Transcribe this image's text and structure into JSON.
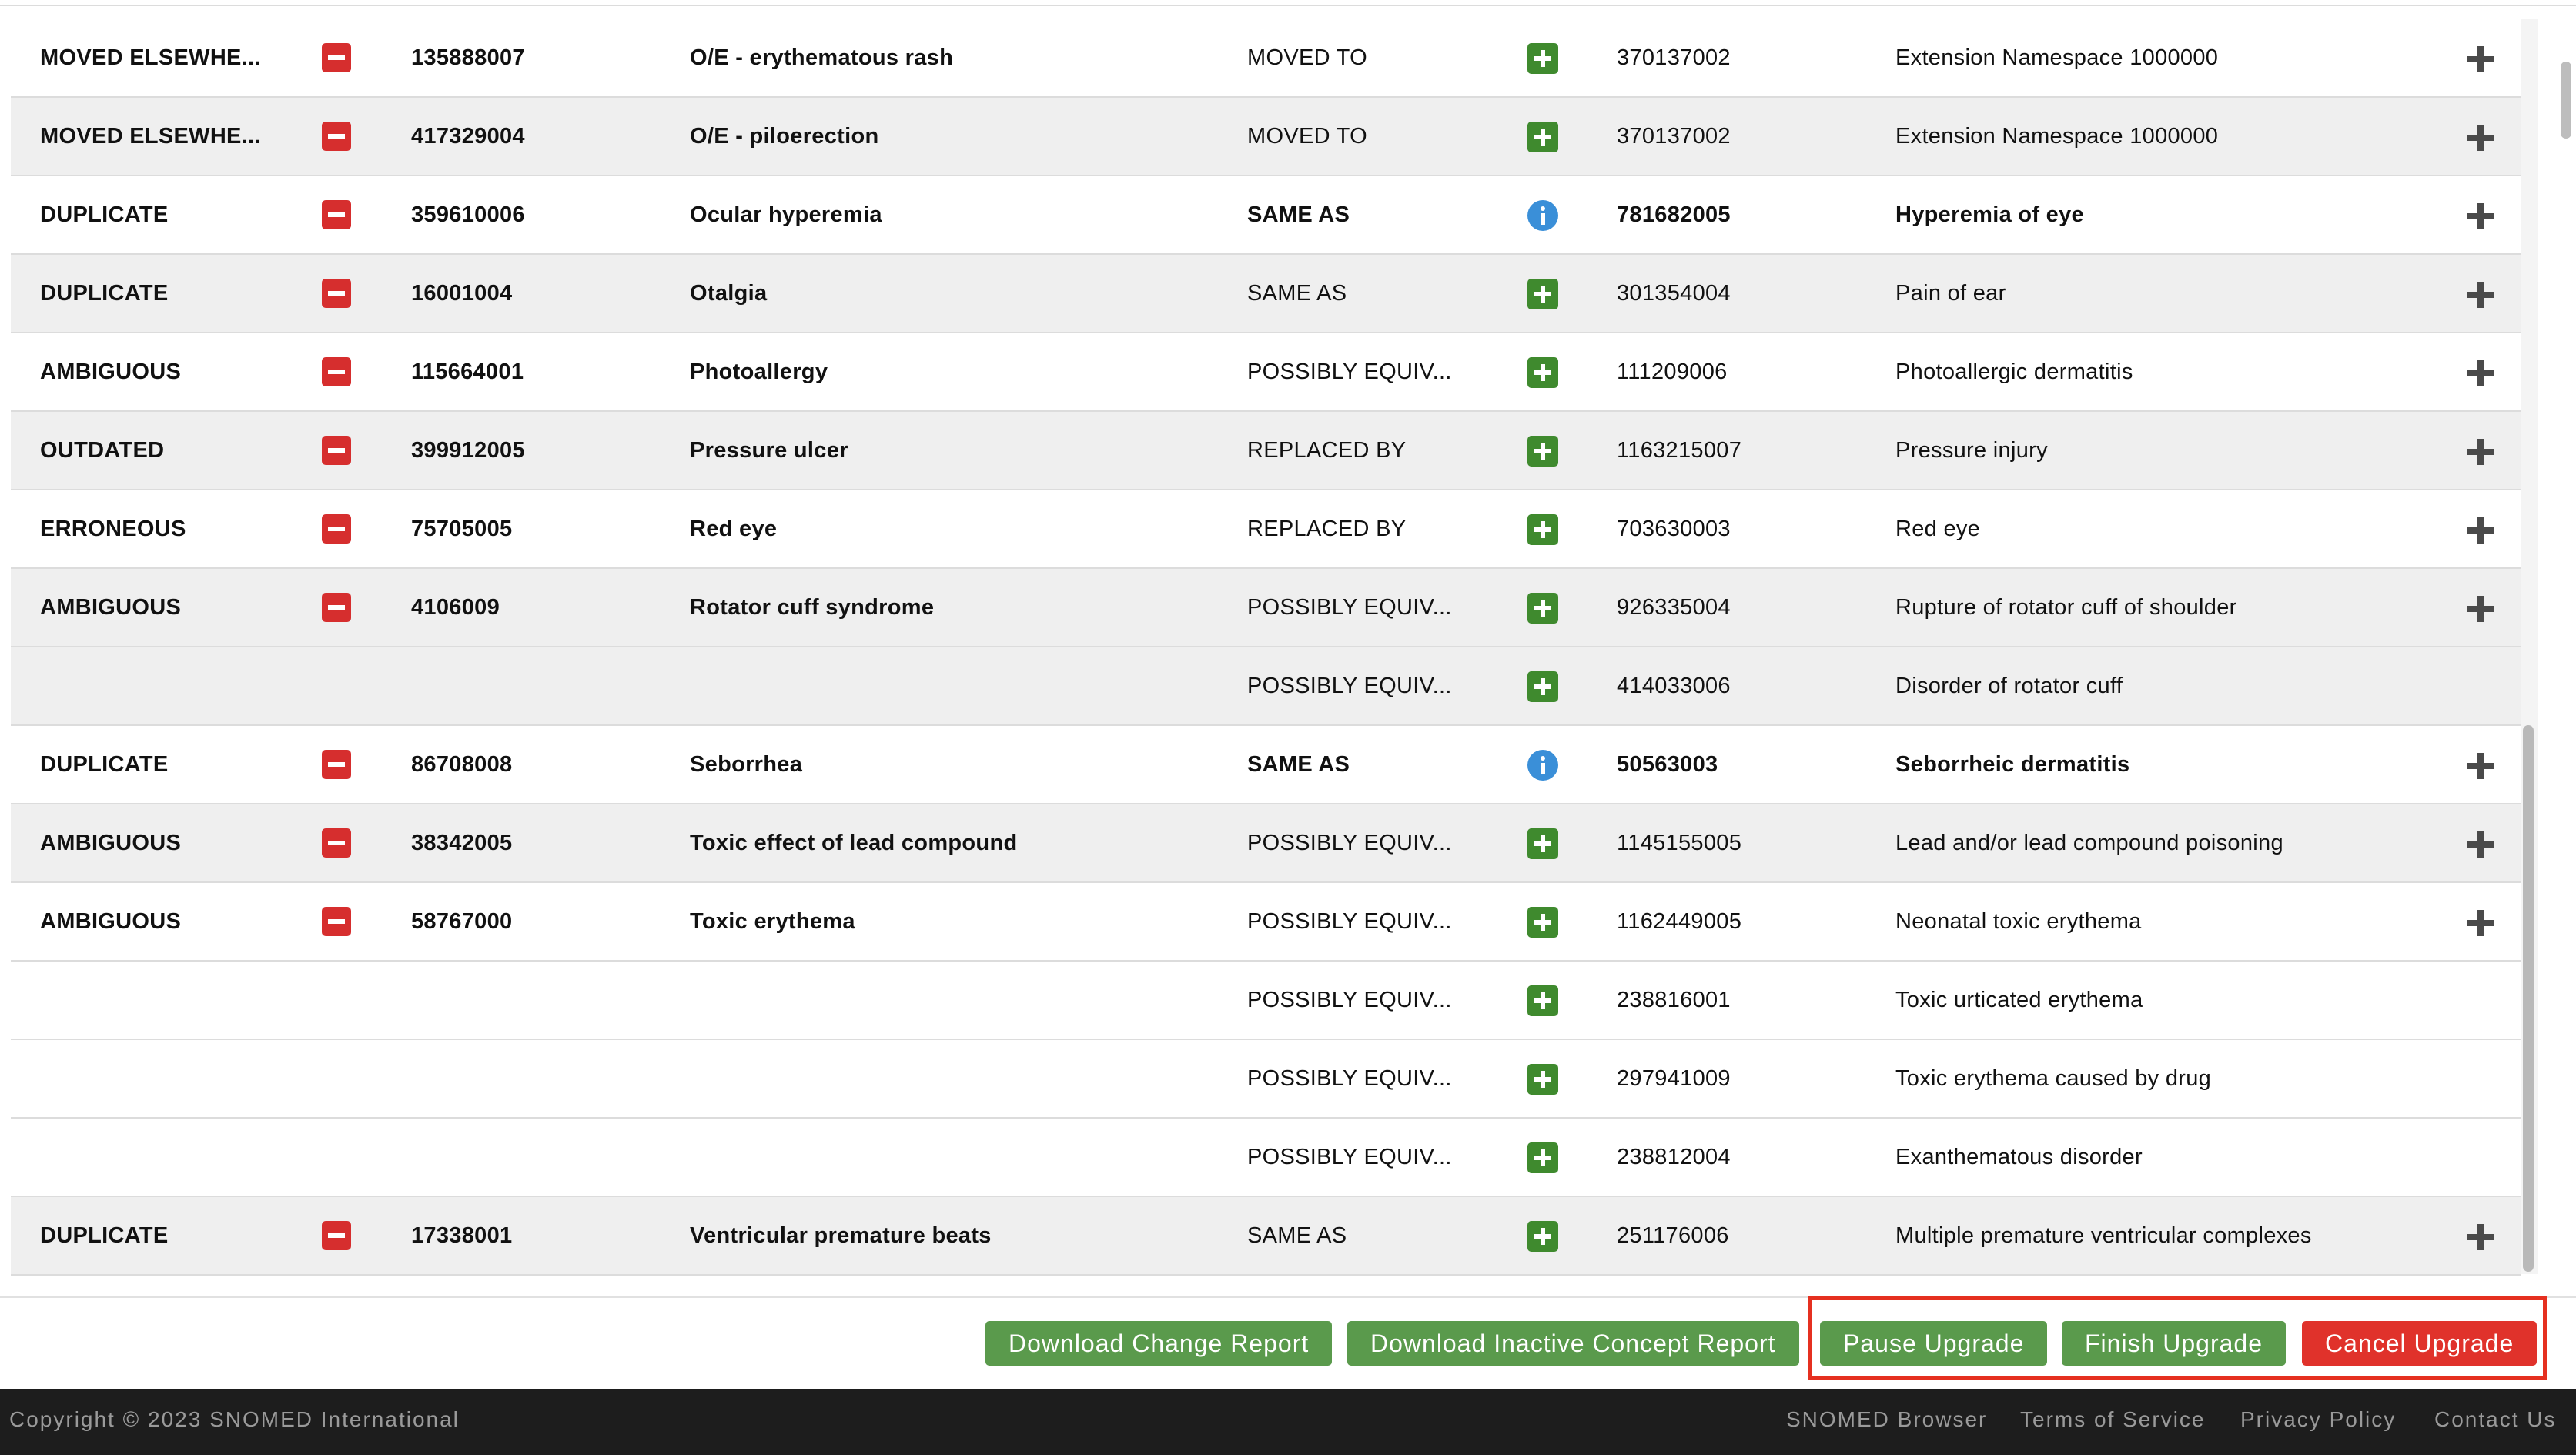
{
  "table": {
    "rows": [
      {
        "status": "MOVED ELSEWHE...",
        "code": "135888007",
        "description": "O/E - erythematous rash",
        "relationship": "MOVED TO",
        "relationship_icon": "plus-icon",
        "target_code": "370137002",
        "target_description": "Extension Namespace 1000000",
        "target_bold": false,
        "shaded": false,
        "has_remove": true,
        "has_add": true
      },
      {
        "status": "MOVED ELSEWHE...",
        "code": "417329004",
        "description": "O/E - piloerection",
        "relationship": "MOVED TO",
        "relationship_icon": "plus-icon",
        "target_code": "370137002",
        "target_description": "Extension Namespace 1000000",
        "target_bold": false,
        "shaded": true,
        "has_remove": true,
        "has_add": true
      },
      {
        "status": "DUPLICATE",
        "code": "359610006",
        "description": "Ocular hyperemia",
        "relationship": "SAME AS",
        "relationship_icon": "info-icon",
        "target_code": "781682005",
        "target_description": "Hyperemia of eye",
        "target_bold": true,
        "shaded": false,
        "has_remove": true,
        "has_add": true
      },
      {
        "status": "DUPLICATE",
        "code": "16001004",
        "description": "Otalgia",
        "relationship": "SAME AS",
        "relationship_icon": "plus-icon",
        "target_code": "301354004",
        "target_description": "Pain of ear",
        "target_bold": false,
        "shaded": true,
        "has_remove": true,
        "has_add": true
      },
      {
        "status": "AMBIGUOUS",
        "code": "115664001",
        "description": "Photoallergy",
        "relationship": "POSSIBLY EQUIV...",
        "relationship_icon": "plus-icon",
        "target_code": "111209006",
        "target_description": "Photoallergic dermatitis",
        "target_bold": false,
        "shaded": false,
        "has_remove": true,
        "has_add": true
      },
      {
        "status": "OUTDATED",
        "code": "399912005",
        "description": "Pressure ulcer",
        "relationship": "REPLACED BY",
        "relationship_icon": "plus-icon",
        "target_code": "1163215007",
        "target_description": "Pressure injury",
        "target_bold": false,
        "shaded": true,
        "has_remove": true,
        "has_add": true
      },
      {
        "status": "ERRONEOUS",
        "code": "75705005",
        "description": "Red eye",
        "relationship": "REPLACED BY",
        "relationship_icon": "plus-icon",
        "target_code": "703630003",
        "target_description": "Red eye",
        "target_bold": false,
        "shaded": false,
        "has_remove": true,
        "has_add": true
      },
      {
        "status": "AMBIGUOUS",
        "code": "4106009",
        "description": "Rotator cuff syndrome",
        "relationship": "POSSIBLY EQUIV...",
        "relationship_icon": "plus-icon",
        "target_code": "926335004",
        "target_description": "Rupture of rotator cuff of shoulder",
        "target_bold": false,
        "shaded": true,
        "has_remove": true,
        "has_add": true
      },
      {
        "status": "",
        "code": "",
        "description": "",
        "relationship": "POSSIBLY EQUIV...",
        "relationship_icon": "plus-icon",
        "target_code": "414033006",
        "target_description": "Disorder of rotator cuff",
        "target_bold": false,
        "shaded": true,
        "has_remove": false,
        "has_add": false
      },
      {
        "status": "DUPLICATE",
        "code": "86708008",
        "description": "Seborrhea",
        "relationship": "SAME AS",
        "relationship_icon": "info-icon",
        "target_code": "50563003",
        "target_description": "Seborrheic dermatitis",
        "target_bold": true,
        "shaded": false,
        "has_remove": true,
        "has_add": true
      },
      {
        "status": "AMBIGUOUS",
        "code": "38342005",
        "description": "Toxic effect of lead compound",
        "relationship": "POSSIBLY EQUIV...",
        "relationship_icon": "plus-icon",
        "target_code": "1145155005",
        "target_description": "Lead and/or lead compound poisoning",
        "target_bold": false,
        "shaded": true,
        "has_remove": true,
        "has_add": true
      },
      {
        "status": "AMBIGUOUS",
        "code": "58767000",
        "description": "Toxic erythema",
        "relationship": "POSSIBLY EQUIV...",
        "relationship_icon": "plus-icon",
        "target_code": "1162449005",
        "target_description": "Neonatal toxic erythema",
        "target_bold": false,
        "shaded": false,
        "has_remove": true,
        "has_add": true
      },
      {
        "status": "",
        "code": "",
        "description": "",
        "relationship": "POSSIBLY EQUIV...",
        "relationship_icon": "plus-icon",
        "target_code": "238816001",
        "target_description": "Toxic urticated erythema",
        "target_bold": false,
        "shaded": false,
        "has_remove": false,
        "has_add": false
      },
      {
        "status": "",
        "code": "",
        "description": "",
        "relationship": "POSSIBLY EQUIV...",
        "relationship_icon": "plus-icon",
        "target_code": "297941009",
        "target_description": "Toxic erythema caused by drug",
        "target_bold": false,
        "shaded": false,
        "has_remove": false,
        "has_add": false
      },
      {
        "status": "",
        "code": "",
        "description": "",
        "relationship": "POSSIBLY EQUIV...",
        "relationship_icon": "plus-icon",
        "target_code": "238812004",
        "target_description": "Exanthematous disorder",
        "target_bold": false,
        "shaded": false,
        "has_remove": false,
        "has_add": false
      },
      {
        "status": "DUPLICATE",
        "code": "17338001",
        "description": "Ventricular premature beats",
        "relationship": "SAME AS",
        "relationship_icon": "plus-icon",
        "target_code": "251176006",
        "target_description": "Multiple premature ventricular complexes",
        "target_bold": false,
        "shaded": true,
        "has_remove": true,
        "has_add": true
      }
    ]
  },
  "actions": {
    "download_change_report": "Download Change Report",
    "download_inactive_report": "Download Inactive Concept Report",
    "pause_upgrade": "Pause Upgrade",
    "finish_upgrade": "Finish Upgrade",
    "cancel_upgrade": "Cancel Upgrade"
  },
  "footer": {
    "copyright": "Copyright © 2023 SNOMED International",
    "links": {
      "browser": "SNOMED Browser",
      "terms": "Terms of Service",
      "privacy": "Privacy Policy",
      "contact": "Contact Us"
    }
  },
  "colors": {
    "remove_red": "#d62e2e",
    "add_green": "#3f8a2e",
    "info_blue": "#3a8fd8",
    "button_green": "#5a9a4c",
    "button_red": "#e0322b",
    "highlight_red": "#e53020",
    "footer_bg": "#1d1d1d"
  }
}
